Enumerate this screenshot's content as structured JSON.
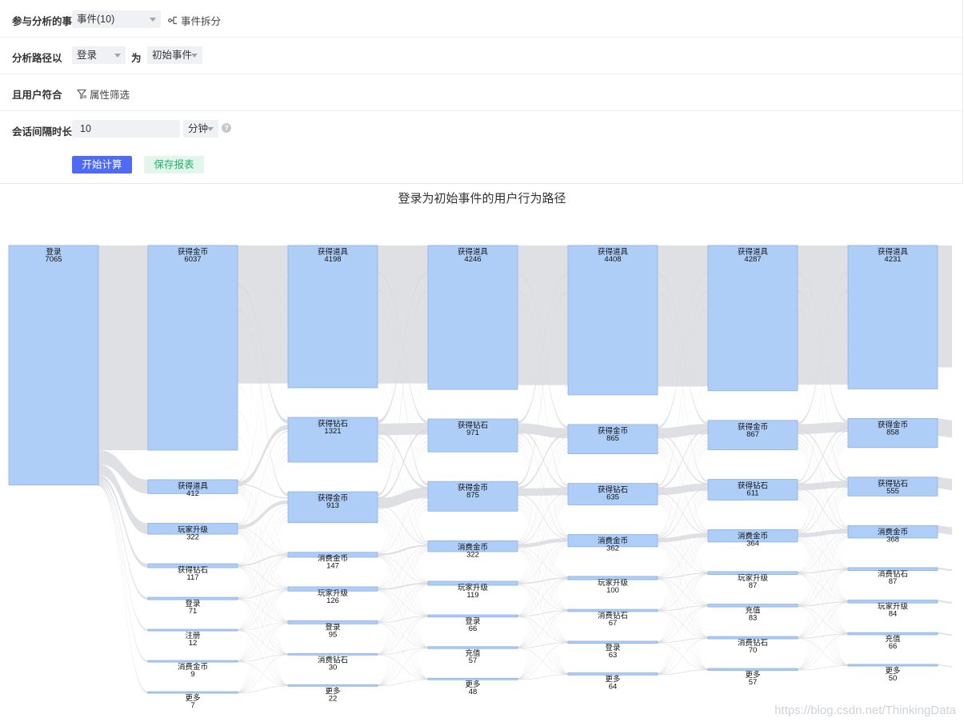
{
  "config": {
    "events_label": "参与分析的事件",
    "events_select": "事件(10)",
    "split_link": "事件拆分",
    "path_label": "分析路径以",
    "path_event_select": "登录",
    "path_as": "为",
    "path_type_select": "初始事件",
    "user_label": "且用户符合",
    "filter_link": "属性筛选",
    "session_label": "会话间隔时长",
    "session_value": "10",
    "session_unit": "分钟",
    "help_icon": "question-circle-icon",
    "start_button": "开始计算",
    "save_button": "保存报表"
  },
  "chart_title": "登录为初始事件的用户行为路径",
  "colors": {
    "primary": "#4f6bf5",
    "node_fill": "#aecdf7",
    "node_stroke": "#8fb2e3",
    "link": "#d9dbde",
    "save_bg": "#e3f6ec",
    "save_text": "#25b06a"
  },
  "chart_data": {
    "type": "sankey",
    "title": "登录为初始事件的用户行为路径",
    "steps": [
      [
        {
          "name": "登录",
          "value": 7065
        }
      ],
      [
        {
          "name": "获得金币",
          "value": 6037
        },
        {
          "name": "获得道具",
          "value": 412
        },
        {
          "name": "玩家升级",
          "value": 322
        },
        {
          "name": "获得钻石",
          "value": 117
        },
        {
          "name": "登录",
          "value": 71
        },
        {
          "name": "注册",
          "value": 12
        },
        {
          "name": "消费金币",
          "value": 9
        },
        {
          "name": "更多",
          "value": 7
        }
      ],
      [
        {
          "name": "获得道具",
          "value": 4198
        },
        {
          "name": "获得钻石",
          "value": 1321
        },
        {
          "name": "获得金币",
          "value": 913
        },
        {
          "name": "消费金币",
          "value": 147
        },
        {
          "name": "玩家升级",
          "value": 126
        },
        {
          "name": "登录",
          "value": 95
        },
        {
          "name": "消费钻石",
          "value": 30
        },
        {
          "name": "更多",
          "value": 22
        }
      ],
      [
        {
          "name": "获得道具",
          "value": 4246
        },
        {
          "name": "获得钻石",
          "value": 971
        },
        {
          "name": "获得金币",
          "value": 875
        },
        {
          "name": "消费金币",
          "value": 322
        },
        {
          "name": "玩家升级",
          "value": 119
        },
        {
          "name": "登录",
          "value": 66
        },
        {
          "name": "充值",
          "value": 57
        },
        {
          "name": "更多",
          "value": 48
        }
      ],
      [
        {
          "name": "获得道具",
          "value": 4408
        },
        {
          "name": "获得金币",
          "value": 865
        },
        {
          "name": "获得钻石",
          "value": 635
        },
        {
          "name": "消费金币",
          "value": 362
        },
        {
          "name": "玩家升级",
          "value": 100
        },
        {
          "name": "消费钻石",
          "value": 67
        },
        {
          "name": "登录",
          "value": 63
        },
        {
          "name": "更多",
          "value": 64
        }
      ],
      [
        {
          "name": "获得道具",
          "value": 4287
        },
        {
          "name": "获得金币",
          "value": 867
        },
        {
          "name": "获得钻石",
          "value": 611
        },
        {
          "name": "消费金币",
          "value": 364
        },
        {
          "name": "玩家升级",
          "value": 87
        },
        {
          "name": "充值",
          "value": 83
        },
        {
          "name": "消费钻石",
          "value": 70
        },
        {
          "name": "更多",
          "value": 57
        }
      ],
      [
        {
          "name": "获得道具",
          "value": 4231
        },
        {
          "name": "获得金币",
          "value": 858
        },
        {
          "name": "获得钻石",
          "value": 555
        },
        {
          "name": "消费金币",
          "value": 368
        },
        {
          "name": "消费钻石",
          "value": 87
        },
        {
          "name": "玩家升级",
          "value": 84
        },
        {
          "name": "充值",
          "value": 66
        },
        {
          "name": "更多",
          "value": 50
        }
      ]
    ]
  },
  "watermark": "https://blog.csdn.net/ThinkingData"
}
